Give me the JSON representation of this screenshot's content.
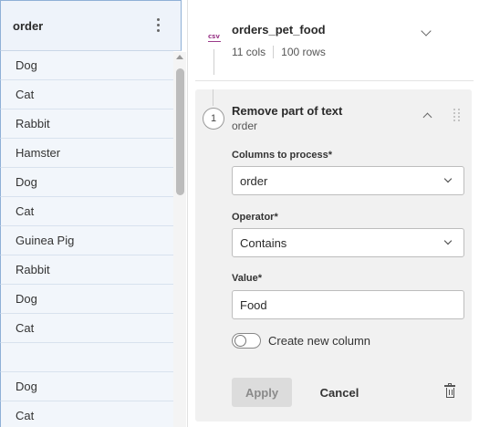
{
  "column_panel": {
    "header": "order",
    "rows": [
      "Dog",
      "Cat",
      "Rabbit",
      "Hamster",
      "Dog",
      "Cat",
      "Guinea Pig",
      "Rabbit",
      "Dog",
      "Cat",
      "",
      "Dog",
      "Cat"
    ]
  },
  "source": {
    "icon_text": "csv",
    "name": "orders_pet_food",
    "cols": "11 cols",
    "rows": "100 rows"
  },
  "step": {
    "number": "1",
    "title": "Remove part of text",
    "subtitle": "order",
    "columns_label": "Columns to process*",
    "columns_value": "order",
    "operator_label": "Operator*",
    "operator_value": "Contains",
    "value_label": "Value*",
    "value_value": "Food",
    "create_column_label": "Create new column",
    "create_column_enabled": false,
    "apply_label": "Apply",
    "cancel_label": "Cancel"
  }
}
